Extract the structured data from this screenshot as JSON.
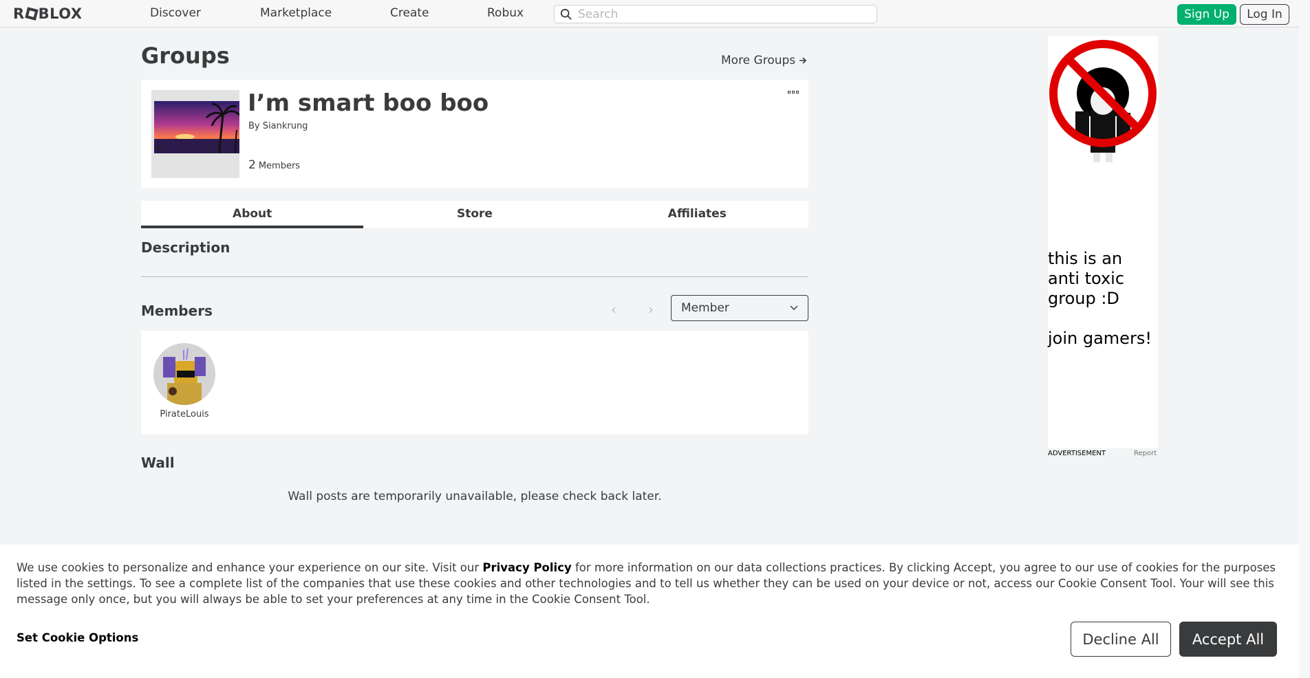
{
  "nav": {
    "logo_text_pre": "R",
    "logo_text_post": "BLOX",
    "links": [
      "Discover",
      "Marketplace",
      "Create",
      "Robux"
    ],
    "search_placeholder": "Search",
    "signup_label": "Sign Up",
    "login_label": "Log In",
    "accent_color": "#00b06f"
  },
  "page": {
    "title": "Groups",
    "more_groups": "More Groups"
  },
  "group": {
    "name": "I’m smart boo boo",
    "by_prefix": "By",
    "owner": "Siankrung",
    "member_count": "2",
    "member_count_label": "Members",
    "menu_icon": "more-dots-icon"
  },
  "tabs": [
    "About",
    "Store",
    "Affiliates"
  ],
  "active_tab": "About",
  "description": {
    "title": "Description"
  },
  "members": {
    "title": "Members",
    "role_selected": "Member",
    "list": [
      {
        "name": "PirateLouis"
      }
    ]
  },
  "wall": {
    "title": "Wall",
    "message": "Wall posts are temporarily unavailable, please check back later."
  },
  "ad": {
    "text": "this is an\nanti toxic\ngroup :D\n\n join gamers!",
    "label": "ADVERTISEMENT",
    "report": "Report"
  },
  "cookie": {
    "text_before": "We use cookies to personalize and enhance your experience on our site. Visit our ",
    "privacy_link": "Privacy Policy",
    "text_after": " for more information on our data collections practices. By clicking Accept, you agree to our use of cookies for the purposes listed in the settings. To see a complete list of the companies that use these cookies and other technologies and to tell us whether they can be used on your device or not, access our Cookie Consent Tool. Your will see this message only once, but you will always be able to set your preferences at any time in the Cookie Consent Tool.",
    "set_options": "Set Cookie Options",
    "decline": "Decline All",
    "accept": "Accept All"
  }
}
